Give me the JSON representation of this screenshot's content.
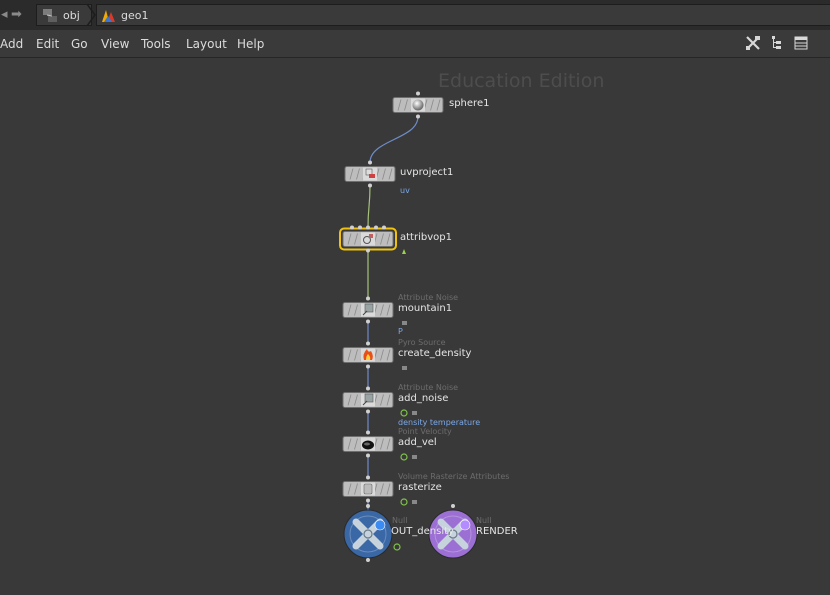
{
  "path": {
    "crumbs": [
      {
        "label": "obj",
        "icon": "obj-network-icon"
      },
      {
        "label": "geo1",
        "icon": "geo-icon"
      }
    ]
  },
  "menu": {
    "items": [
      "Add",
      "Edit",
      "Go",
      "View",
      "Tools",
      "Layout",
      "Help"
    ]
  },
  "toolbar": {
    "icons": [
      "tools-icon",
      "tree-view-icon",
      "list-view-icon"
    ]
  },
  "network": {
    "watermark": "Education Edition",
    "nodes": [
      {
        "id": "sphere1",
        "type_label": "",
        "name": "sphere1",
        "attr": "",
        "icon": "sphere-icon"
      },
      {
        "id": "uvproject1",
        "type_label": "",
        "name": "uvproject1",
        "attr": "uv",
        "icon": "uv-project-icon"
      },
      {
        "id": "attribvop1",
        "type_label": "",
        "name": "attribvop1",
        "attr": "",
        "icon": "vop-icon"
      },
      {
        "id": "mountain1",
        "type_label": "Attribute Noise",
        "name": "mountain1",
        "attr": "P",
        "icon": "noise-icon"
      },
      {
        "id": "create_density",
        "type_label": "Pyro Source",
        "name": "create_density",
        "attr": "",
        "icon": "fire-icon"
      },
      {
        "id": "add_noise",
        "type_label": "Attribute Noise",
        "name": "add_noise",
        "attr": "density temperature",
        "icon": "noise-icon"
      },
      {
        "id": "add_vel",
        "type_label": "Point Velocity",
        "name": "add_vel",
        "attr": "",
        "icon": "velocity-icon"
      },
      {
        "id": "rasterize",
        "type_label": "Volume Rasterize Attributes",
        "name": "rasterize",
        "attr": "",
        "icon": "rasterize-icon"
      },
      {
        "id": "OUT_density",
        "type_label": "Null",
        "name": "OUT_density",
        "attr": "",
        "icon": "null-icon"
      },
      {
        "id": "RENDER",
        "type_label": "Null",
        "name": "RENDER",
        "attr": "",
        "icon": "null-icon"
      }
    ],
    "connections": [
      [
        "sphere1",
        "uvproject1"
      ],
      [
        "uvproject1",
        "attribvop1"
      ],
      [
        "attribvop1",
        "mountain1"
      ],
      [
        "mountain1",
        "create_density"
      ],
      [
        "create_density",
        "add_noise"
      ],
      [
        "add_noise",
        "add_vel"
      ],
      [
        "add_vel",
        "rasterize"
      ],
      [
        "rasterize",
        "OUT_density"
      ]
    ],
    "colors": {
      "wire": "#6f8cc8",
      "wire_green": "#a7c27a",
      "selected": "#f0c20e",
      "out_null": "#3a67a5",
      "render_null": "#9b6fd3"
    }
  }
}
